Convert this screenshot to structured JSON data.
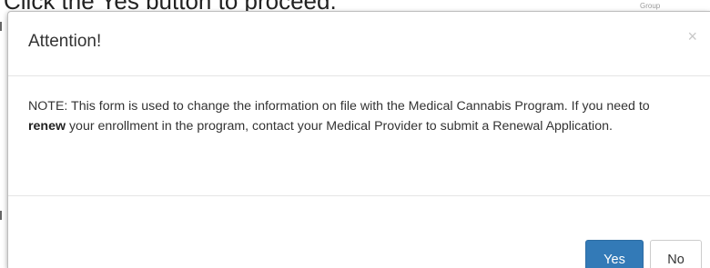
{
  "background": {
    "instruction_text": "Click the Yes button to proceed.",
    "corner_text": "Group"
  },
  "modal": {
    "title": "Attention!",
    "close_symbol": "×",
    "body": {
      "part1": "NOTE: This form is used to change the information on file with the Medical Cannabis Program. If you need to ",
      "bold": "renew",
      "part2": " your enrollment in the program, contact your Medical Provider to submit a Renewal Application."
    },
    "buttons": {
      "yes_label": "Yes",
      "no_label": "No"
    }
  },
  "colors": {
    "primary_button": "#337ab7",
    "title_text": "#333333"
  },
  "icons": {
    "close": "close-icon"
  }
}
